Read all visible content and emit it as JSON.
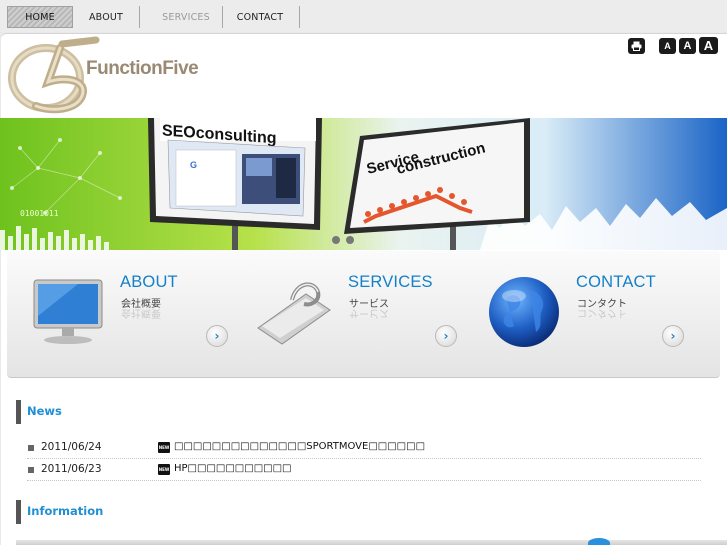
{
  "nav": {
    "items": [
      {
        "label": "HOME"
      },
      {
        "label": "ABOUT"
      },
      {
        "label": "SERVICES"
      },
      {
        "label": "CONTACT"
      }
    ]
  },
  "logo": {
    "text": "FunctionFive",
    "mark": "f5"
  },
  "tools": {
    "print_icon": "print-icon",
    "small": "A",
    "medium": "A",
    "large": "A"
  },
  "hero": {
    "billboard_left": "SEOconsulting",
    "billboard_right_line1": "Service",
    "billboard_right_line2": "construction",
    "binary": "01001011"
  },
  "features": [
    {
      "title": "ABOUT",
      "sub": "会社概要",
      "icon": "monitor-icon"
    },
    {
      "title": "SERVICES",
      "sub": "サービス",
      "icon": "clip-icon"
    },
    {
      "title": "CONTACT",
      "sub": "コンタクト",
      "icon": "globe-icon"
    }
  ],
  "news": {
    "title": "News",
    "items": [
      {
        "date": "2011/06/24",
        "badge": "NEW",
        "text": "□□□□□□□□□□□□□□SPORTMOVE□□□□□□"
      },
      {
        "date": "2011/06/23",
        "badge": "NEW",
        "text": "HP□□□□□□□□□□□"
      }
    ]
  },
  "information": {
    "title": "Information"
  },
  "colors": {
    "accent": "#1f8fd6",
    "feature_title": "#1480c8",
    "logo": "#9a8a74"
  }
}
